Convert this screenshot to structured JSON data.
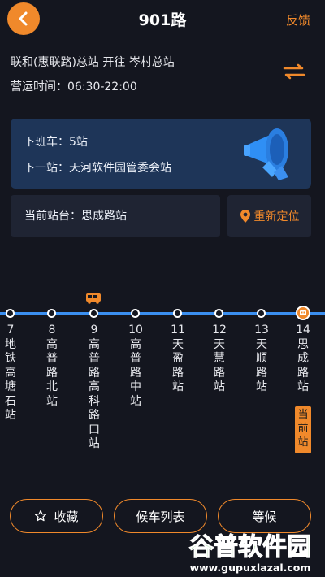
{
  "header": {
    "title": "901路",
    "feedback_label": "反馈"
  },
  "route": {
    "direction": "联和(惠联路)总站 开往 岑村总站",
    "hours": "营运时间：06:30-22:00"
  },
  "alert": {
    "alight": "下班车：5站",
    "next_stop": "下一站：天河软件园管委会站"
  },
  "current_station": {
    "label": "当前站台：思成路站",
    "relocate_label": "重新定位"
  },
  "stops": [
    {
      "num": "7",
      "name": "地铁高塘石站"
    },
    {
      "num": "8",
      "name": "高普路北站"
    },
    {
      "num": "9",
      "name": "高普路高科路口站"
    },
    {
      "num": "10",
      "name": "高普路中站"
    },
    {
      "num": "11",
      "name": "天盈路站"
    },
    {
      "num": "12",
      "name": "天慧路站"
    },
    {
      "num": "13",
      "name": "天顺路站"
    },
    {
      "num": "14",
      "name": "思成路站"
    }
  ],
  "current_badge": "当前站",
  "actions": {
    "favorite": "收藏",
    "schedule": "候车列表",
    "wait": "等候"
  },
  "watermark": {
    "brand": "谷普软件园",
    "url": "www.gupuxlazal.com"
  },
  "colors": {
    "accent": "#f0892b",
    "track": "#3b8ff0",
    "card": "#1e3558",
    "background": "#14161f"
  }
}
